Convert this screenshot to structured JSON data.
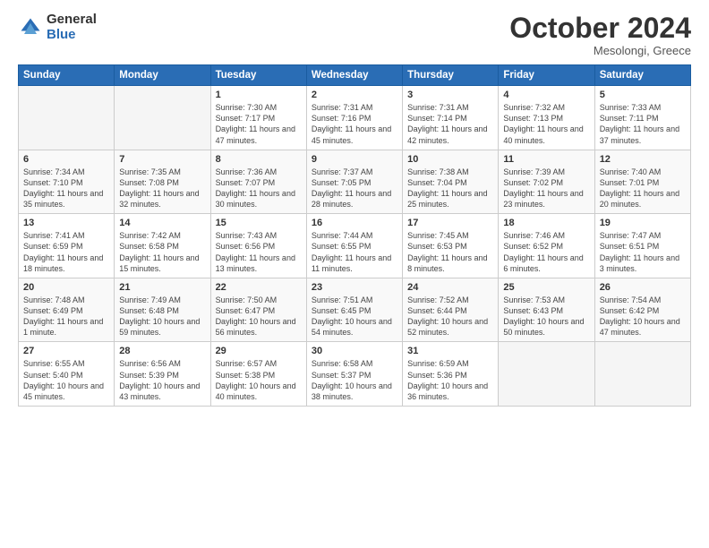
{
  "logo": {
    "general": "General",
    "blue": "Blue"
  },
  "header": {
    "month": "October 2024",
    "location": "Mesolongi, Greece"
  },
  "weekdays": [
    "Sunday",
    "Monday",
    "Tuesday",
    "Wednesday",
    "Thursday",
    "Friday",
    "Saturday"
  ],
  "weeks": [
    [
      {
        "day": "",
        "sunrise": "",
        "sunset": "",
        "daylight": ""
      },
      {
        "day": "",
        "sunrise": "",
        "sunset": "",
        "daylight": ""
      },
      {
        "day": "1",
        "sunrise": "Sunrise: 7:30 AM",
        "sunset": "Sunset: 7:17 PM",
        "daylight": "Daylight: 11 hours and 47 minutes."
      },
      {
        "day": "2",
        "sunrise": "Sunrise: 7:31 AM",
        "sunset": "Sunset: 7:16 PM",
        "daylight": "Daylight: 11 hours and 45 minutes."
      },
      {
        "day": "3",
        "sunrise": "Sunrise: 7:31 AM",
        "sunset": "Sunset: 7:14 PM",
        "daylight": "Daylight: 11 hours and 42 minutes."
      },
      {
        "day": "4",
        "sunrise": "Sunrise: 7:32 AM",
        "sunset": "Sunset: 7:13 PM",
        "daylight": "Daylight: 11 hours and 40 minutes."
      },
      {
        "day": "5",
        "sunrise": "Sunrise: 7:33 AM",
        "sunset": "Sunset: 7:11 PM",
        "daylight": "Daylight: 11 hours and 37 minutes."
      }
    ],
    [
      {
        "day": "6",
        "sunrise": "Sunrise: 7:34 AM",
        "sunset": "Sunset: 7:10 PM",
        "daylight": "Daylight: 11 hours and 35 minutes."
      },
      {
        "day": "7",
        "sunrise": "Sunrise: 7:35 AM",
        "sunset": "Sunset: 7:08 PM",
        "daylight": "Daylight: 11 hours and 32 minutes."
      },
      {
        "day": "8",
        "sunrise": "Sunrise: 7:36 AM",
        "sunset": "Sunset: 7:07 PM",
        "daylight": "Daylight: 11 hours and 30 minutes."
      },
      {
        "day": "9",
        "sunrise": "Sunrise: 7:37 AM",
        "sunset": "Sunset: 7:05 PM",
        "daylight": "Daylight: 11 hours and 28 minutes."
      },
      {
        "day": "10",
        "sunrise": "Sunrise: 7:38 AM",
        "sunset": "Sunset: 7:04 PM",
        "daylight": "Daylight: 11 hours and 25 minutes."
      },
      {
        "day": "11",
        "sunrise": "Sunrise: 7:39 AM",
        "sunset": "Sunset: 7:02 PM",
        "daylight": "Daylight: 11 hours and 23 minutes."
      },
      {
        "day": "12",
        "sunrise": "Sunrise: 7:40 AM",
        "sunset": "Sunset: 7:01 PM",
        "daylight": "Daylight: 11 hours and 20 minutes."
      }
    ],
    [
      {
        "day": "13",
        "sunrise": "Sunrise: 7:41 AM",
        "sunset": "Sunset: 6:59 PM",
        "daylight": "Daylight: 11 hours and 18 minutes."
      },
      {
        "day": "14",
        "sunrise": "Sunrise: 7:42 AM",
        "sunset": "Sunset: 6:58 PM",
        "daylight": "Daylight: 11 hours and 15 minutes."
      },
      {
        "day": "15",
        "sunrise": "Sunrise: 7:43 AM",
        "sunset": "Sunset: 6:56 PM",
        "daylight": "Daylight: 11 hours and 13 minutes."
      },
      {
        "day": "16",
        "sunrise": "Sunrise: 7:44 AM",
        "sunset": "Sunset: 6:55 PM",
        "daylight": "Daylight: 11 hours and 11 minutes."
      },
      {
        "day": "17",
        "sunrise": "Sunrise: 7:45 AM",
        "sunset": "Sunset: 6:53 PM",
        "daylight": "Daylight: 11 hours and 8 minutes."
      },
      {
        "day": "18",
        "sunrise": "Sunrise: 7:46 AM",
        "sunset": "Sunset: 6:52 PM",
        "daylight": "Daylight: 11 hours and 6 minutes."
      },
      {
        "day": "19",
        "sunrise": "Sunrise: 7:47 AM",
        "sunset": "Sunset: 6:51 PM",
        "daylight": "Daylight: 11 hours and 3 minutes."
      }
    ],
    [
      {
        "day": "20",
        "sunrise": "Sunrise: 7:48 AM",
        "sunset": "Sunset: 6:49 PM",
        "daylight": "Daylight: 11 hours and 1 minute."
      },
      {
        "day": "21",
        "sunrise": "Sunrise: 7:49 AM",
        "sunset": "Sunset: 6:48 PM",
        "daylight": "Daylight: 10 hours and 59 minutes."
      },
      {
        "day": "22",
        "sunrise": "Sunrise: 7:50 AM",
        "sunset": "Sunset: 6:47 PM",
        "daylight": "Daylight: 10 hours and 56 minutes."
      },
      {
        "day": "23",
        "sunrise": "Sunrise: 7:51 AM",
        "sunset": "Sunset: 6:45 PM",
        "daylight": "Daylight: 10 hours and 54 minutes."
      },
      {
        "day": "24",
        "sunrise": "Sunrise: 7:52 AM",
        "sunset": "Sunset: 6:44 PM",
        "daylight": "Daylight: 10 hours and 52 minutes."
      },
      {
        "day": "25",
        "sunrise": "Sunrise: 7:53 AM",
        "sunset": "Sunset: 6:43 PM",
        "daylight": "Daylight: 10 hours and 50 minutes."
      },
      {
        "day": "26",
        "sunrise": "Sunrise: 7:54 AM",
        "sunset": "Sunset: 6:42 PM",
        "daylight": "Daylight: 10 hours and 47 minutes."
      }
    ],
    [
      {
        "day": "27",
        "sunrise": "Sunrise: 6:55 AM",
        "sunset": "Sunset: 5:40 PM",
        "daylight": "Daylight: 10 hours and 45 minutes."
      },
      {
        "day": "28",
        "sunrise": "Sunrise: 6:56 AM",
        "sunset": "Sunset: 5:39 PM",
        "daylight": "Daylight: 10 hours and 43 minutes."
      },
      {
        "day": "29",
        "sunrise": "Sunrise: 6:57 AM",
        "sunset": "Sunset: 5:38 PM",
        "daylight": "Daylight: 10 hours and 40 minutes."
      },
      {
        "day": "30",
        "sunrise": "Sunrise: 6:58 AM",
        "sunset": "Sunset: 5:37 PM",
        "daylight": "Daylight: 10 hours and 38 minutes."
      },
      {
        "day": "31",
        "sunrise": "Sunrise: 6:59 AM",
        "sunset": "Sunset: 5:36 PM",
        "daylight": "Daylight: 10 hours and 36 minutes."
      },
      {
        "day": "",
        "sunrise": "",
        "sunset": "",
        "daylight": ""
      },
      {
        "day": "",
        "sunrise": "",
        "sunset": "",
        "daylight": ""
      }
    ]
  ]
}
